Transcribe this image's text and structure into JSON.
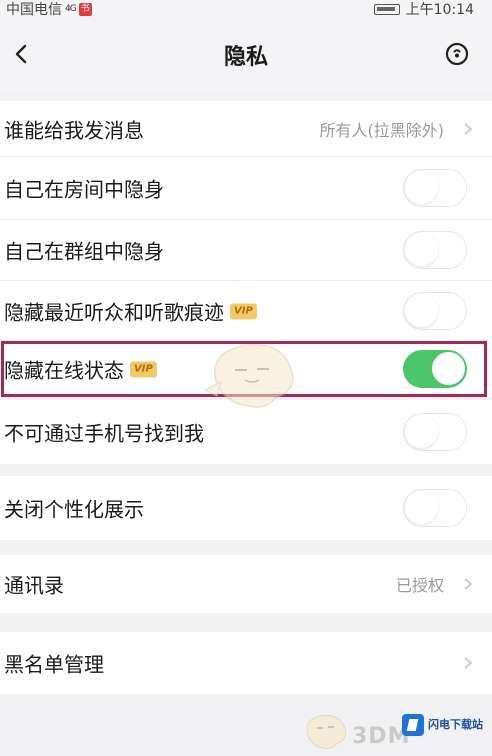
{
  "status_bar": {
    "carrier": "中国电信",
    "signal": "4G",
    "app_badge": "书",
    "time": "上午10:14"
  },
  "header": {
    "title": "隐私",
    "back_icon": "chevron-left-icon",
    "right_icon": "help-circle-icon"
  },
  "settings": [
    {
      "label": "谁能给我发消息",
      "value": "所有人(拉黑除外)",
      "type": "link"
    },
    {
      "label": "自己在房间中隐身",
      "type": "toggle",
      "on": false
    },
    {
      "label": "自己在群组中隐身",
      "type": "toggle",
      "on": false
    },
    {
      "label": "隐藏最近听众和听歌痕迹",
      "vip": "VIP",
      "type": "toggle",
      "on": false
    },
    {
      "label": "隐藏在线状态",
      "vip": "VIP",
      "type": "toggle",
      "on": true
    },
    {
      "label": "不可通过手机号找到我",
      "type": "toggle",
      "on": false
    },
    {
      "label": "关闭个性化展示",
      "type": "toggle",
      "on": false
    },
    {
      "label": "通讯录",
      "value": "已授权",
      "type": "link"
    },
    {
      "label": "黑名单管理",
      "type": "link"
    }
  ],
  "watermark": {
    "brand": "3DM",
    "site_name": "闪电下载站"
  },
  "colors": {
    "toggle_on": "#4bc66a",
    "highlight_border": "#a42a55",
    "vip_badge": "#f3c86a"
  }
}
